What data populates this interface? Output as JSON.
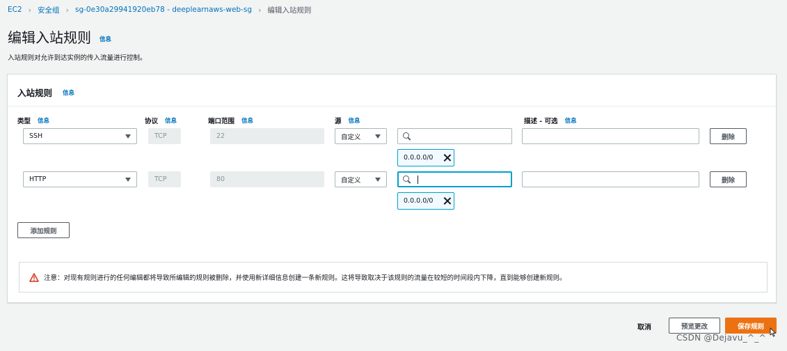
{
  "breadcrumb": {
    "items": [
      "EC2",
      "安全组",
      "sg-0e30a29941920eb78 - deeplearnaws-web-sg",
      "编辑入站规则"
    ]
  },
  "page": {
    "title": "编辑入站规则",
    "info": "信息",
    "description": "入站规则对允许到达实例的传入流量进行控制。"
  },
  "panel": {
    "title": "入站规则",
    "info": "信息",
    "columns": {
      "type": "类型",
      "protocol": "协议",
      "port_range": "端口范围",
      "source": "源",
      "description": "描述 - 可选"
    },
    "column_info": "信息",
    "rules": [
      {
        "type": "SSH",
        "protocol": "TCP",
        "port": "22",
        "source_type": "自定义",
        "search_value": "",
        "cidr": "0.0.0.0/0",
        "description": "",
        "delete_label": "删除"
      },
      {
        "type": "HTTP",
        "protocol": "TCP",
        "port": "80",
        "source_type": "自定义",
        "search_value": "",
        "cidr": "0.0.0.0/0",
        "description": "",
        "delete_label": "删除"
      }
    ],
    "add_rule_label": "添加规则",
    "notice": "注意：对现有规则进行的任何编辑都将导致所编辑的规则被删除，并使用新详细信息创建一条新规则。这将导致取决于该规则的流量在较短的时间段内下降，直到能够创建新规则。"
  },
  "footer": {
    "cancel_label": "取消",
    "preview_label": "预览更改",
    "save_label": "保存规则"
  },
  "watermark": "CSDN @Dejavu_^_^",
  "colors": {
    "primary": "#ec7211",
    "link": "#0073bb",
    "focus": "#00a1c9",
    "warning": "#d13212"
  }
}
